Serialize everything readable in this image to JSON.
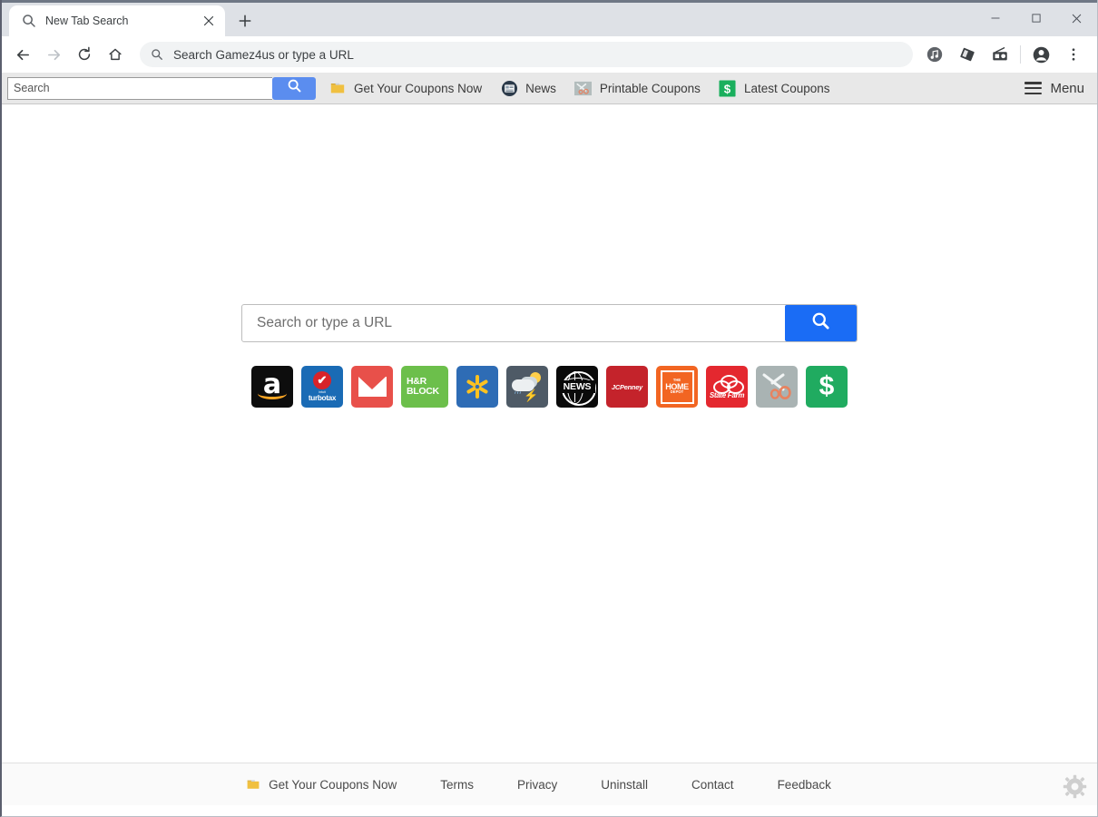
{
  "window": {
    "controls": [
      {
        "name": "minimize",
        "glyph": "minimize-icon"
      },
      {
        "name": "maximize",
        "glyph": "maximize-icon"
      },
      {
        "name": "close",
        "glyph": "close-icon"
      }
    ]
  },
  "tab": {
    "title": "New Tab Search",
    "favicon": "search-icon",
    "close_label": "×",
    "newtab_label": "+"
  },
  "navbar": {
    "back": "back-arrow-icon",
    "forward": "forward-arrow-icon",
    "reload": "reload-icon",
    "home": "home-icon",
    "omnibox_text": "Search Gamez4us or type a URL",
    "omnibox_icon": "search-icon",
    "right_icons": [
      "music-note-icon",
      "extension-puzzle-icon",
      "radio-icon",
      "profile-avatar-icon",
      "three-dot-menu-icon"
    ]
  },
  "extension_bar": {
    "search_placeholder": "Search",
    "search_value": "",
    "search_button_icon": "search-icon",
    "links": [
      {
        "label": "Get Your Coupons Now",
        "icon": "yellow-folder-icon"
      },
      {
        "label": "News",
        "icon": "newspaper-circle-icon"
      },
      {
        "label": "Printable Coupons",
        "icon": "scissors-icon"
      },
      {
        "label": "Latest Coupons",
        "icon": "green-dollar-icon"
      }
    ],
    "menu_label": "Menu",
    "menu_icon": "hamburger-icon"
  },
  "main": {
    "search_placeholder": "Search or type a URL",
    "search_value": "",
    "search_button_icon": "search-icon",
    "search_button_color": "#1a6cf5",
    "tiles": [
      {
        "name": "amazon",
        "label": "Amazon",
        "glyph": "a",
        "bg": "#0d0d0d"
      },
      {
        "name": "turbotax",
        "label": "TurboTax",
        "brand_small": "intuit",
        "glyph": "turbotax",
        "check": "✔",
        "bg": "#1a6bb5"
      },
      {
        "name": "gmail",
        "label": "Gmail",
        "glyph": "envelope",
        "bg": "#e8504a"
      },
      {
        "name": "hrblock",
        "label": "H&R Block",
        "line1": "H&R",
        "line2": "BLOCK",
        "bg": "#6cbf4b"
      },
      {
        "name": "walmart",
        "label": "Walmart",
        "glyph": "spark",
        "bg": "#2e6cb5"
      },
      {
        "name": "weather",
        "label": "Weather",
        "glyph": "cloud-sun-storm",
        "bolt": "⚡",
        "rain": "′′′",
        "bg": "#4e5a66"
      },
      {
        "name": "news",
        "label": "News",
        "glyph": "NEWS",
        "bg": "#0a0a0a"
      },
      {
        "name": "jcpenney",
        "label": "JCPenney",
        "glyph": "JCPenney",
        "bg": "#c4232b"
      },
      {
        "name": "homedepot",
        "label": "The Home Depot",
        "line1": "THE",
        "line2": "HOME",
        "line3": "DEPOT",
        "bg": "#f26522"
      },
      {
        "name": "statefarm",
        "label": "State Farm",
        "glyph": "State Farm",
        "bg": "#e4282f"
      },
      {
        "name": "printable-coupons",
        "label": "Printable Coupons",
        "glyph": "scissors",
        "bg": "#a9b3b3"
      },
      {
        "name": "latest-coupons",
        "label": "Latest Coupons",
        "glyph": "$",
        "bg": "#20ab60"
      }
    ]
  },
  "footer": {
    "links": [
      {
        "label": "Get Your Coupons Now",
        "icon": "yellow-folder-icon"
      },
      {
        "label": "Terms",
        "icon": ""
      },
      {
        "label": "Privacy",
        "icon": ""
      },
      {
        "label": "Uninstall",
        "icon": ""
      },
      {
        "label": "Contact",
        "icon": ""
      },
      {
        "label": "Feedback",
        "icon": ""
      }
    ],
    "settings_icon": "gear-icon"
  }
}
